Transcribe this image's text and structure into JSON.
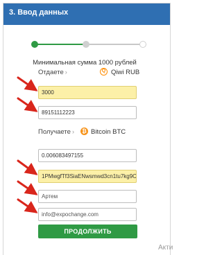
{
  "header": {
    "title": "3. Ввод данных"
  },
  "stepper": {
    "total_steps": 3,
    "current_step": 1
  },
  "min_sum": "Минимальная сумма 1000 рублей",
  "give": {
    "label": "Отдаете",
    "arrow": "›",
    "currency": "Qiwi RUB",
    "coin_icon": "qiwi-icon",
    "coin_glyph": "Q",
    "color": "#ff8c00"
  },
  "get": {
    "label": "Получаете",
    "arrow": "›",
    "currency": "Bitcoin BTC",
    "coin_icon": "bitcoin-icon",
    "coin_glyph": "₿",
    "color": "#f7931a"
  },
  "fields": {
    "amount_give": "3000",
    "qiwi_wallet": "89151112223",
    "amount_get": "0.006083497155",
    "btc_address": "1PMwgfTf3SiaENwsmwd3cn1tu7kg9Cd\\",
    "name": "Артем",
    "email": "info@expochange.com"
  },
  "colors": {
    "header_bg": "#2f6fb2",
    "accent_green": "#2f9a44",
    "highlight_yellow": "#fcf0a8",
    "annotation_red": "#d9261c"
  },
  "submit_label": "ПРОДОЛЖИТЬ",
  "watermark": "Акти"
}
